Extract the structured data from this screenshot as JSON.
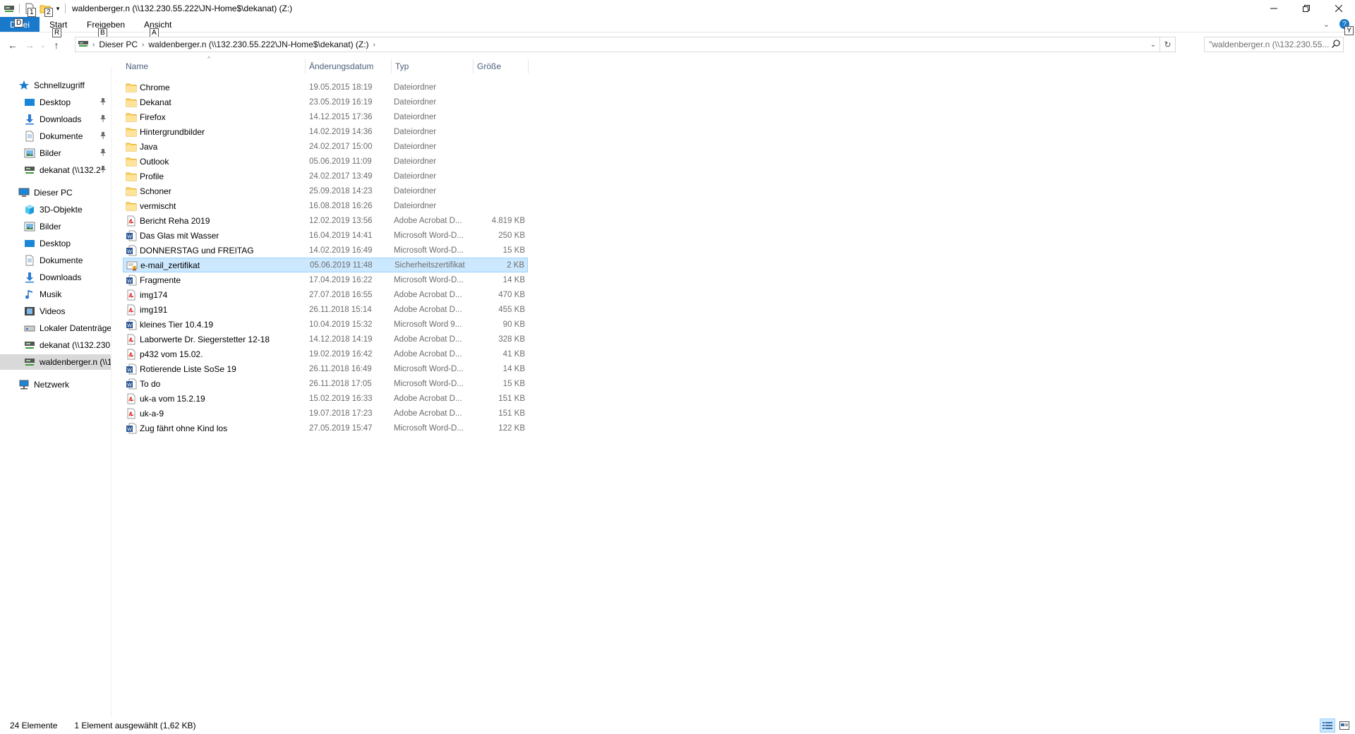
{
  "window": {
    "title": "waldenberger.n (\\\\132.230.55.222\\JN-Home$\\dekanat) (Z:)",
    "keytips": [
      "1",
      "2"
    ]
  },
  "ribbon": {
    "file_label": "Datei",
    "file_keytip": "D",
    "tabs": [
      {
        "label": "Start",
        "keytip": "R"
      },
      {
        "label": "Freigeben",
        "keytip": "B"
      },
      {
        "label": "Ansicht",
        "keytip": "A"
      }
    ],
    "help_keytip": "Y"
  },
  "address": {
    "crumbs": [
      "Dieser PC",
      "waldenberger.n (\\\\132.230.55.222\\JN-Home$\\dekanat) (Z:)"
    ]
  },
  "search": {
    "placeholder": "\"waldenberger.n (\\\\132.230.55..."
  },
  "navpane": {
    "items": [
      {
        "label": "Schnellzugriff",
        "icon": "star-icon",
        "level": 0,
        "pinned": false
      },
      {
        "label": "Desktop",
        "icon": "desktop-icon",
        "level": 1,
        "pinned": true
      },
      {
        "label": "Downloads",
        "icon": "download-icon",
        "level": 1,
        "pinned": true
      },
      {
        "label": "Dokumente",
        "icon": "document-icon",
        "level": 1,
        "pinned": true
      },
      {
        "label": "Bilder",
        "icon": "pictures-icon",
        "level": 1,
        "pinned": true
      },
      {
        "label": "dekanat (\\\\132.2",
        "icon": "network-drive-icon",
        "level": 1,
        "pinned": true
      },
      {
        "label": "Dieser PC",
        "icon": "computer-icon",
        "level": 0,
        "pinned": false
      },
      {
        "label": "3D-Objekte",
        "icon": "cube-icon",
        "level": 1,
        "pinned": false
      },
      {
        "label": "Bilder",
        "icon": "pictures-icon",
        "level": 1,
        "pinned": false
      },
      {
        "label": "Desktop",
        "icon": "desktop-icon",
        "level": 1,
        "pinned": false
      },
      {
        "label": "Dokumente",
        "icon": "document-icon",
        "level": 1,
        "pinned": false
      },
      {
        "label": "Downloads",
        "icon": "download-icon",
        "level": 1,
        "pinned": false
      },
      {
        "label": "Musik",
        "icon": "music-icon",
        "level": 1,
        "pinned": false
      },
      {
        "label": "Videos",
        "icon": "video-icon",
        "level": 1,
        "pinned": false
      },
      {
        "label": "Lokaler Datenträger",
        "icon": "disk-icon",
        "level": 1,
        "pinned": false
      },
      {
        "label": "dekanat (\\\\132.230.5",
        "icon": "network-drive-icon",
        "level": 1,
        "pinned": false
      },
      {
        "label": "waldenberger.n (\\\\1",
        "icon": "network-drive-icon",
        "level": 1,
        "pinned": false,
        "selected": true
      },
      {
        "label": "Netzwerk",
        "icon": "network-icon",
        "level": 0,
        "pinned": false
      }
    ]
  },
  "columns": {
    "name": "Name",
    "date": "Änderungsdatum",
    "type": "Typ",
    "size": "Größe"
  },
  "files": [
    {
      "name": "Chrome",
      "date": "19.05.2015 18:19",
      "type": "Dateiordner",
      "size": "",
      "icon": "folder-icon"
    },
    {
      "name": "Dekanat",
      "date": "23.05.2019 16:19",
      "type": "Dateiordner",
      "size": "",
      "icon": "folder-icon"
    },
    {
      "name": "Firefox",
      "date": "14.12.2015 17:36",
      "type": "Dateiordner",
      "size": "",
      "icon": "folder-icon"
    },
    {
      "name": "Hintergrundbilder",
      "date": "14.02.2019 14:36",
      "type": "Dateiordner",
      "size": "",
      "icon": "folder-icon"
    },
    {
      "name": "Java",
      "date": "24.02.2017 15:00",
      "type": "Dateiordner",
      "size": "",
      "icon": "folder-icon"
    },
    {
      "name": "Outlook",
      "date": "05.06.2019 11:09",
      "type": "Dateiordner",
      "size": "",
      "icon": "folder-icon"
    },
    {
      "name": "Profile",
      "date": "24.02.2017 13:49",
      "type": "Dateiordner",
      "size": "",
      "icon": "folder-icon"
    },
    {
      "name": "Schoner",
      "date": "25.09.2018 14:23",
      "type": "Dateiordner",
      "size": "",
      "icon": "folder-icon"
    },
    {
      "name": "vermischt",
      "date": "16.08.2018 16:26",
      "type": "Dateiordner",
      "size": "",
      "icon": "folder-icon"
    },
    {
      "name": "Bericht Reha 2019",
      "date": "12.02.2019 13:56",
      "type": "Adobe Acrobat D...",
      "size": "4.819 KB",
      "icon": "pdf-icon"
    },
    {
      "name": "Das Glas mit Wasser",
      "date": "16.04.2019 14:41",
      "type": "Microsoft Word-D...",
      "size": "250 KB",
      "icon": "word-icon"
    },
    {
      "name": "DONNERSTAG und FREITAG",
      "date": "14.02.2019 16:49",
      "type": "Microsoft Word-D...",
      "size": "15 KB",
      "icon": "word-icon"
    },
    {
      "name": "e-mail_zertifikat",
      "date": "05.06.2019 11:48",
      "type": "Sicherheitszertifikat",
      "size": "2 KB",
      "icon": "certificate-icon",
      "selected": true
    },
    {
      "name": "Fragmente",
      "date": "17.04.2019 16:22",
      "type": "Microsoft Word-D...",
      "size": "14 KB",
      "icon": "word-icon"
    },
    {
      "name": "img174",
      "date": "27.07.2018 16:55",
      "type": "Adobe Acrobat D...",
      "size": "470 KB",
      "icon": "pdf-icon"
    },
    {
      "name": "img191",
      "date": "26.11.2018 15:14",
      "type": "Adobe Acrobat D...",
      "size": "455 KB",
      "icon": "pdf-icon"
    },
    {
      "name": "kleines Tier 10.4.19",
      "date": "10.04.2019 15:32",
      "type": "Microsoft Word 9...",
      "size": "90 KB",
      "icon": "word-icon"
    },
    {
      "name": "Laborwerte Dr. Siegerstetter 12-18",
      "date": "14.12.2018 14:19",
      "type": "Adobe Acrobat D...",
      "size": "328 KB",
      "icon": "pdf-icon"
    },
    {
      "name": "p432 vom 15.02.",
      "date": "19.02.2019 16:42",
      "type": "Adobe Acrobat D...",
      "size": "41 KB",
      "icon": "pdf-icon"
    },
    {
      "name": "Rotierende Liste SoSe 19",
      "date": "26.11.2018 16:49",
      "type": "Microsoft Word-D...",
      "size": "14 KB",
      "icon": "word-icon"
    },
    {
      "name": "To do",
      "date": "26.11.2018 17:05",
      "type": "Microsoft Word-D...",
      "size": "15 KB",
      "icon": "word-icon"
    },
    {
      "name": "uk-a vom 15.2.19",
      "date": "15.02.2019 16:33",
      "type": "Adobe Acrobat D...",
      "size": "151 KB",
      "icon": "pdf-icon"
    },
    {
      "name": "uk-a-9",
      "date": "19.07.2018 17:23",
      "type": "Adobe Acrobat D...",
      "size": "151 KB",
      "icon": "pdf-icon"
    },
    {
      "name": "Zug fährt ohne Kind los",
      "date": "27.05.2019 15:47",
      "type": "Microsoft Word-D...",
      "size": "122 KB",
      "icon": "word-icon"
    }
  ],
  "status": {
    "count": "24 Elemente",
    "selection": "1 Element ausgewählt (1,62 KB)"
  },
  "colors": {
    "accent": "#1979ca",
    "selection_bg": "#cce8ff",
    "selection_border": "#99d1ff",
    "folder": "#ffd769",
    "pdf": "#d9302b",
    "word": "#2b5797"
  }
}
